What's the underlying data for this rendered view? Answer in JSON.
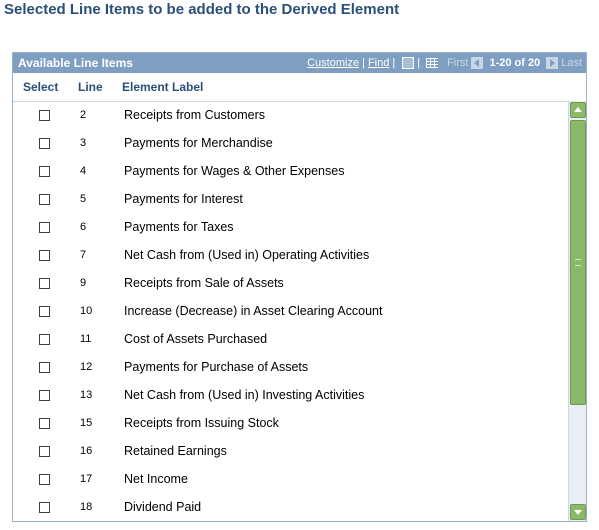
{
  "page_title": "Selected Line Items to be added to the Derived Element",
  "grid": {
    "title": "Available Line Items",
    "nav": {
      "customize": "Customize",
      "separator": "|",
      "find": "Find",
      "first": "First",
      "range": "1-20 of 20",
      "last": "Last"
    },
    "columns": {
      "select": "Select",
      "line": "Line",
      "label": "Element Label"
    },
    "rows": [
      {
        "line": "2",
        "label": "Receipts from Customers",
        "checked": false
      },
      {
        "line": "3",
        "label": "Payments for Merchandise",
        "checked": false
      },
      {
        "line": "4",
        "label": "Payments for Wages & Other Expenses",
        "checked": false
      },
      {
        "line": "5",
        "label": "Payments for Interest",
        "checked": false
      },
      {
        "line": "6",
        "label": "Payments for Taxes",
        "checked": false
      },
      {
        "line": "7",
        "label": "Net Cash from (Used in) Operating Activities",
        "checked": false
      },
      {
        "line": "9",
        "label": "Receipts from Sale of Assets",
        "checked": false
      },
      {
        "line": "10",
        "label": "Increase (Decrease) in Asset Clearing Account",
        "checked": false
      },
      {
        "line": "11",
        "label": "Cost of Assets Purchased",
        "checked": false
      },
      {
        "line": "12",
        "label": "Payments for Purchase of Assets",
        "checked": false
      },
      {
        "line": "13",
        "label": "Net Cash from (Used in) Investing Activities",
        "checked": false
      },
      {
        "line": "15",
        "label": "Receipts from Issuing Stock",
        "checked": false
      },
      {
        "line": "16",
        "label": "Retained Earnings",
        "checked": false
      },
      {
        "line": "17",
        "label": "Net Income",
        "checked": false
      },
      {
        "line": "18",
        "label": "Dividend Paid",
        "checked": false
      }
    ]
  },
  "colors": {
    "title": "#2b4e7a",
    "grid_header": "#7f9fc2",
    "scrollbar": "#8cb86a"
  }
}
